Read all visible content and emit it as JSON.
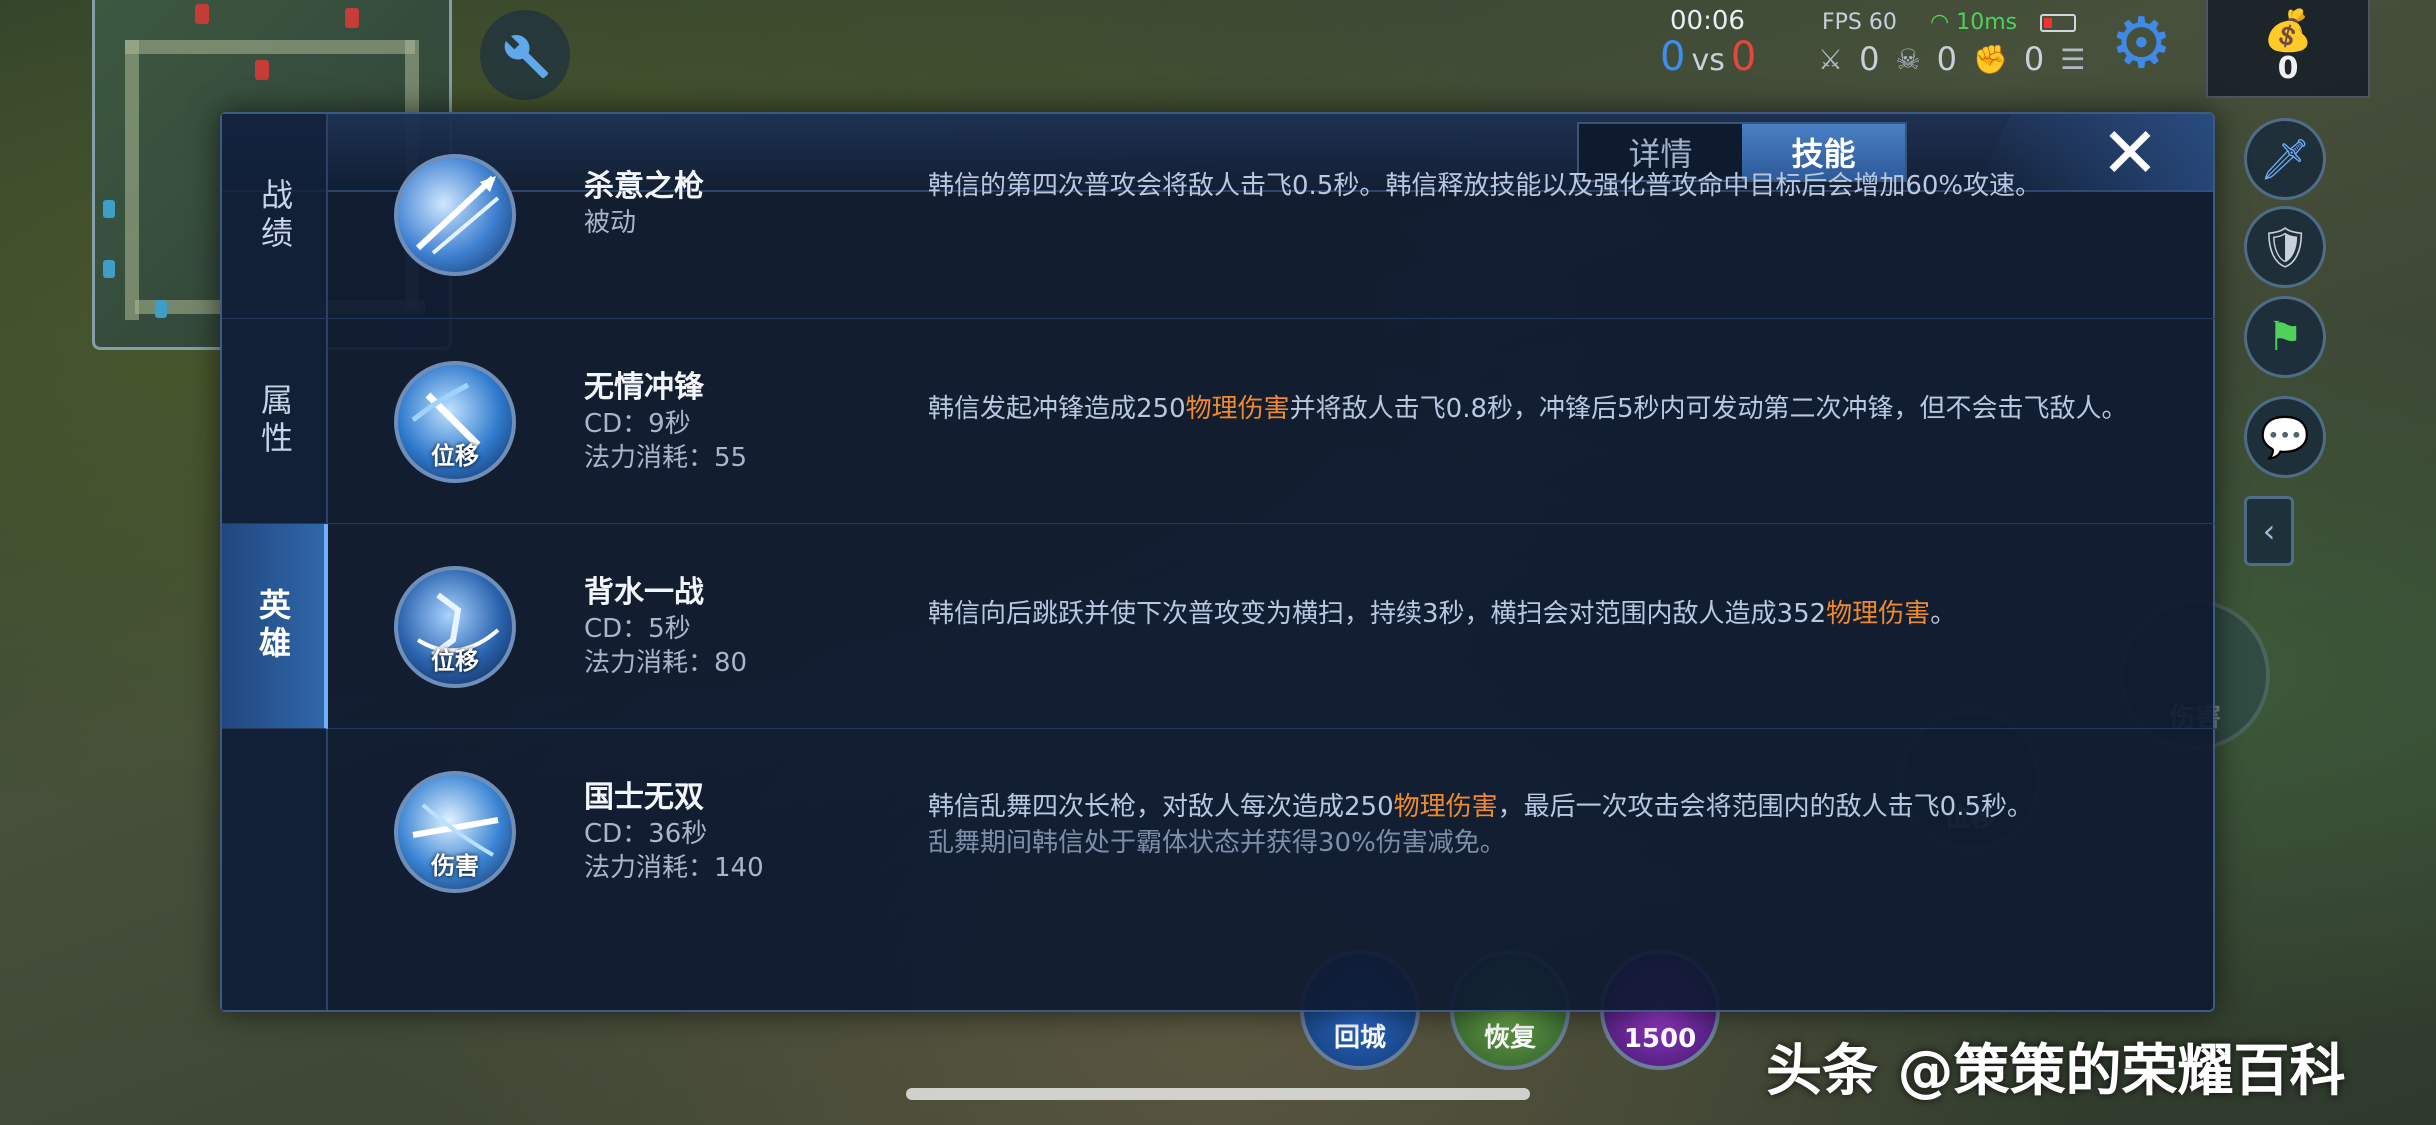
{
  "hud": {
    "timer": "00:06",
    "score_blue": "0",
    "score_vs": "vs",
    "score_red": "0",
    "fps": "FPS 60",
    "ping": "10ms",
    "kills": "0",
    "deaths": "0",
    "assists": "0",
    "gold": "0"
  },
  "panel": {
    "tabs": [
      {
        "label": "详情"
      },
      {
        "label": "技能"
      }
    ],
    "active_tab": "技能",
    "sidebar": [
      {
        "label": "战绩"
      },
      {
        "label": "属性"
      },
      {
        "label": "英雄"
      }
    ],
    "active_sidebar": "英雄",
    "skills": [
      {
        "name": "杀意之枪",
        "type": "被动",
        "icon_tag": "",
        "desc_parts": [
          "韩信的第四次普攻会将敌人击飞0.5秒。韩信释放技能以及强化普攻命中目标后会增加60%攻速。"
        ]
      },
      {
        "name": "无情冲锋",
        "cd": "CD：9秒",
        "mana": "法力消耗：55",
        "icon_tag": "位移",
        "desc_a": "韩信发起冲锋造成250",
        "desc_hl": "物理伤害",
        "desc_b": "并将敌人击飞0.8秒，冲锋后5秒内可发动第二次冲锋，但不会击飞敌人。"
      },
      {
        "name": "背水一战",
        "cd": "CD：5秒",
        "mana": "法力消耗：80",
        "icon_tag": "位移",
        "desc_a": "韩信向后跳跃并使下次普攻变为横扫，持续3秒，横扫会对范围内敌人造成352",
        "desc_hl": "物理伤害",
        "desc_b": "。"
      },
      {
        "name": "国士无双",
        "cd": "CD：36秒",
        "mana": "法力消耗：140",
        "icon_tag": "伤害",
        "desc_a": "韩信乱舞四次长枪，对敌人每次造成250",
        "desc_hl": "物理伤害",
        "desc_b": "，最后一次攻击会将范围内的敌人击飞0.5秒。",
        "desc_c": "乱舞期间韩信处于霸体状态并获得30%伤害减免。"
      }
    ]
  },
  "bottom_buttons": {
    "recall": "回城",
    "heal": "恢复",
    "summoner_cost": "1500"
  },
  "background_labels": {
    "damage": "伤害",
    "dash": "位移"
  },
  "watermark": "头条 @策策的荣耀百科",
  "icons": [
    "wrench-icon",
    "gear-icon",
    "money-bag-icon",
    "sword-icon",
    "shield-icon",
    "flag-icon",
    "chat-icon",
    "close-icon"
  ],
  "colors": {
    "accent_blue": "#3b8ff0",
    "enemy_red": "#e4473c",
    "highlight_orange": "#f08a2c",
    "ping_green": "#4fd15a"
  }
}
